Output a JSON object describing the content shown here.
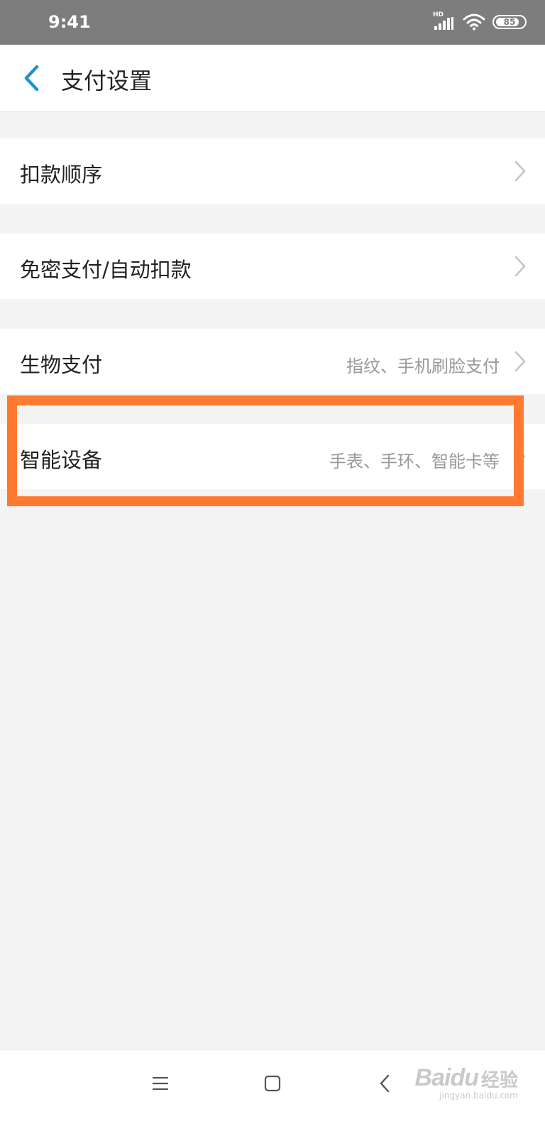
{
  "status_bar": {
    "time": "9:41",
    "network": "HD",
    "battery": "85",
    "battery_fraction": 0.85
  },
  "header": {
    "title": "支付设置",
    "back_icon": "chevron-left-icon"
  },
  "settings": [
    {
      "label": "扣款顺序",
      "detail": ""
    },
    {
      "label": "免密支付/自动扣款",
      "detail": ""
    },
    {
      "label": "生物支付",
      "detail": "指纹、手机刷脸支付"
    },
    {
      "label": "智能设备",
      "detail": "手表、手环、智能卡等"
    }
  ],
  "nav_bar": {
    "icons": [
      "menu-icon",
      "home-icon",
      "back-icon"
    ]
  },
  "watermark": {
    "brand": "Baidu",
    "name": "经验",
    "url": "jingyan.baidu.com"
  },
  "colors": {
    "accent": "#1e90d6",
    "highlight": "#ff7a30",
    "status_bar": "#7d7d7d",
    "background": "#f4f4f4"
  }
}
